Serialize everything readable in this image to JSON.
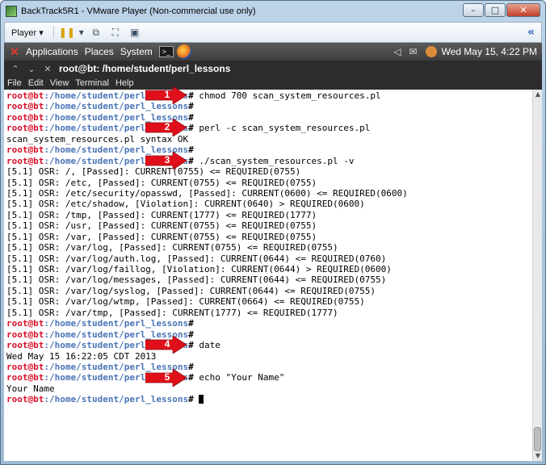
{
  "vm": {
    "title": "BackTrack5R1 - VMware Player (Non-commercial use only)",
    "controls": {
      "minimize": "–",
      "maximize": "□",
      "close": "✕"
    },
    "toolbar": {
      "player_label": "Player ▾",
      "pause_icon": "pause-icon",
      "collapse": "«"
    }
  },
  "panel": {
    "menus": [
      "Applications",
      "Places",
      "System"
    ],
    "clock": "Wed May 15,  4:22 PM",
    "term_icon_label": ">_"
  },
  "terminal_window": {
    "title": "root@bt: /home/student/perl_lessons",
    "menu": [
      "File",
      "Edit",
      "View",
      "Terminal",
      "Help"
    ]
  },
  "terminal": {
    "prompt_user": "root@bt",
    "prompt_path": ":/home/student/perl_lessons",
    "prompt_hash": "#",
    "lines": [
      {
        "type": "prompt",
        "cmd": " chmod 700 scan_system_resources.pl"
      },
      {
        "type": "prompt",
        "cmd": ""
      },
      {
        "type": "prompt",
        "cmd": ""
      },
      {
        "type": "prompt",
        "cmd": " perl -c scan_system_resources.pl"
      },
      {
        "type": "output",
        "text": "scan_system_resources.pl syntax OK"
      },
      {
        "type": "prompt",
        "cmd": ""
      },
      {
        "type": "prompt",
        "cmd": " ./scan_system_resources.pl -v"
      },
      {
        "type": "output",
        "text": "[5.1] OSR: /, [Passed]: CURRENT(0755) <= REQUIRED(0755)"
      },
      {
        "type": "output",
        "text": "[5.1] OSR: /etc, [Passed]: CURRENT(0755) <= REQUIRED(0755)"
      },
      {
        "type": "output",
        "text": "[5.1] OSR: /etc/security/opasswd, [Passed]: CURRENT(0600) <= REQUIRED(0600)"
      },
      {
        "type": "output",
        "text": "[5.1] OSR: /etc/shadow, [Violation]: CURRENT(0640) > REQUIRED(0600)"
      },
      {
        "type": "output",
        "text": "[5.1] OSR: /tmp, [Passed]: CURRENT(1777) <= REQUIRED(1777)"
      },
      {
        "type": "output",
        "text": "[5.1] OSR: /usr, [Passed]: CURRENT(0755) <= REQUIRED(0755)"
      },
      {
        "type": "output",
        "text": "[5.1] OSR: /var, [Passed]: CURRENT(0755) <= REQUIRED(0755)"
      },
      {
        "type": "output",
        "text": "[5.1] OSR: /var/log, [Passed]: CURRENT(0755) <= REQUIRED(0755)"
      },
      {
        "type": "output",
        "text": "[5.1] OSR: /var/log/auth.log, [Passed]: CURRENT(0644) <= REQUIRED(0760)"
      },
      {
        "type": "output",
        "text": "[5.1] OSR: /var/log/faillog, [Violation]: CURRENT(0644) > REQUIRED(0600)"
      },
      {
        "type": "output",
        "text": "[5.1] OSR: /var/log/messages, [Passed]: CURRENT(0644) <= REQUIRED(0755)"
      },
      {
        "type": "output",
        "text": "[5.1] OSR: /var/log/syslog, [Passed]: CURRENT(0644) <= REQUIRED(0755)"
      },
      {
        "type": "output",
        "text": "[5.1] OSR: /var/log/wtmp, [Passed]: CURRENT(0664) <= REQUIRED(0755)"
      },
      {
        "type": "output",
        "text": "[5.1] OSR: /var/tmp, [Passed]: CURRENT(1777) <= REQUIRED(1777)"
      },
      {
        "type": "prompt",
        "cmd": ""
      },
      {
        "type": "prompt",
        "cmd": ""
      },
      {
        "type": "prompt",
        "cmd": " date"
      },
      {
        "type": "output",
        "text": "Wed May 15 16:22:05 CDT 2013"
      },
      {
        "type": "prompt",
        "cmd": ""
      },
      {
        "type": "prompt",
        "cmd": " echo \"Your Name\""
      },
      {
        "type": "output",
        "text": "Your Name"
      },
      {
        "type": "prompt",
        "cmd": " ",
        "cursor": true
      }
    ]
  },
  "annotations": {
    "steps": [
      {
        "number": "1",
        "line": 0
      },
      {
        "number": "2",
        "line": 3
      },
      {
        "number": "3",
        "line": 6
      },
      {
        "number": "4",
        "line": 23
      },
      {
        "number": "5",
        "line": 26
      }
    ],
    "arrow_color": "#e0101a"
  }
}
